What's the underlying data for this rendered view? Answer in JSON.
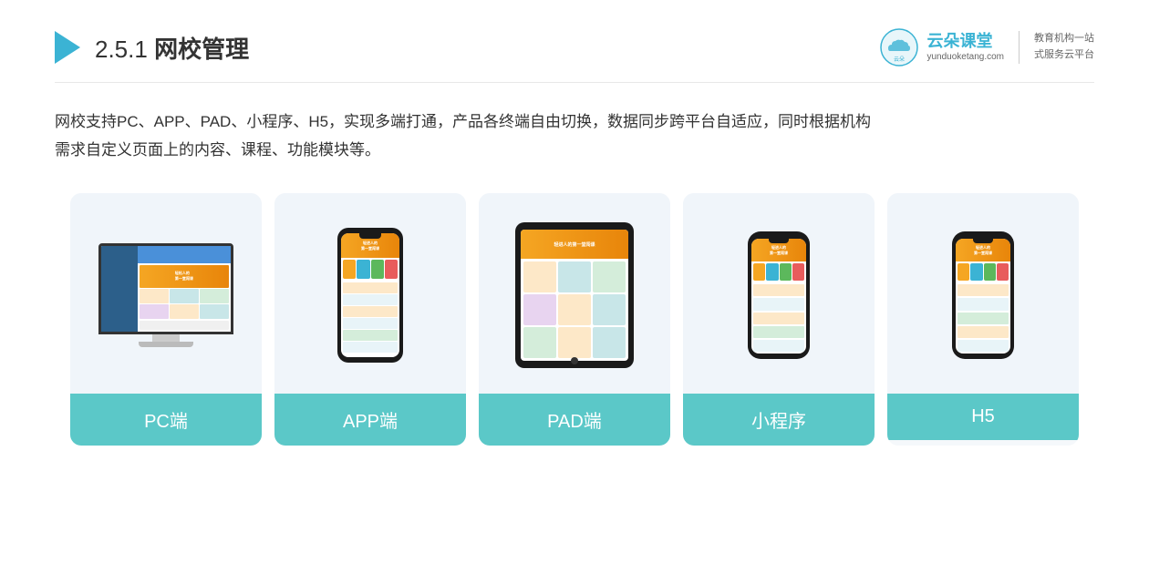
{
  "header": {
    "title_num": "2.5.1 ",
    "title_text": "网校管理",
    "brand": {
      "name": "云朵课堂",
      "sub": "yunduoketang.com",
      "slogan_line1": "教育机构一站",
      "slogan_line2": "式服务云平台"
    }
  },
  "description": {
    "text": "网校支持PC、APP、PAD、小程序、H5，实现多端打通，产品各终端自由切换，数据同步跨平台自适应，同时根据机构\n需求自定义页面上的内容、课程、功能模块等。"
  },
  "cards": [
    {
      "label": "PC端"
    },
    {
      "label": "APP端"
    },
    {
      "label": "PAD端"
    },
    {
      "label": "小程序"
    },
    {
      "label": "H5"
    }
  ]
}
